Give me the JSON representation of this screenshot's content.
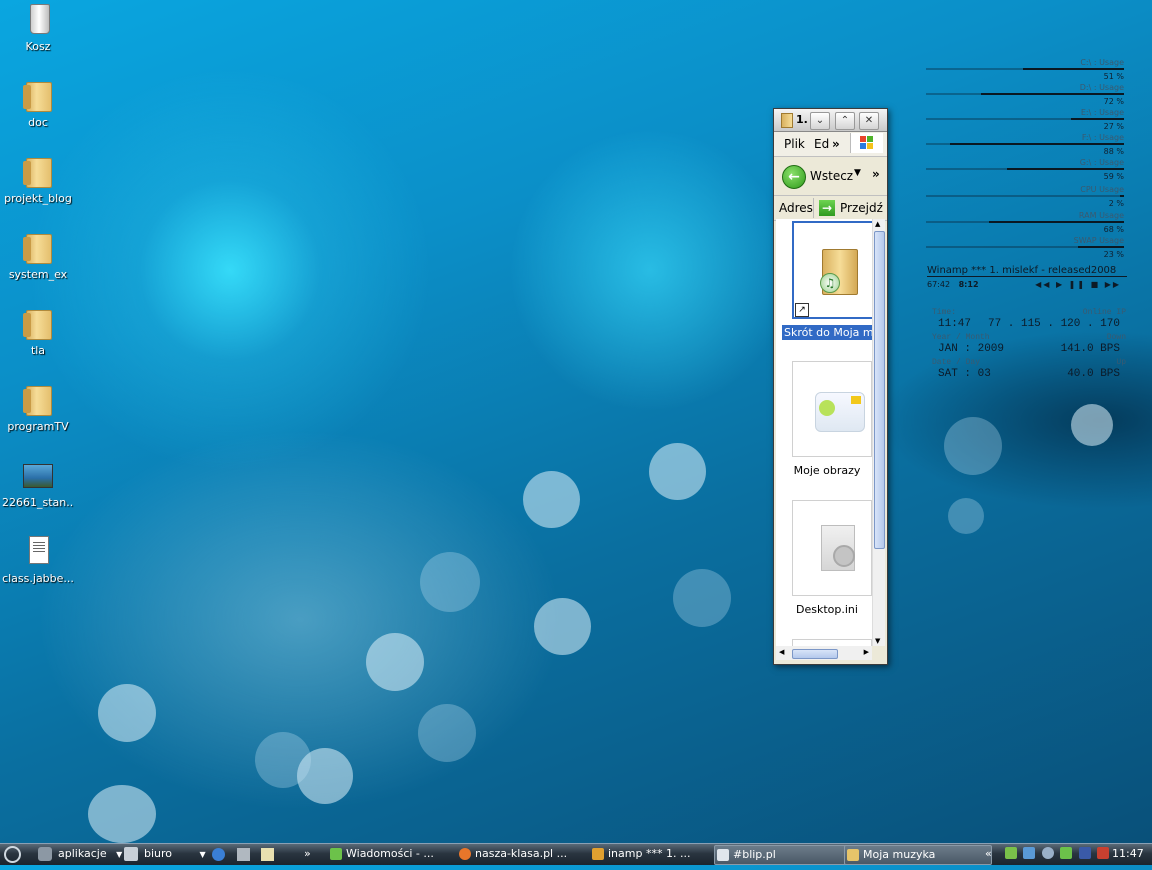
{
  "desktop_icons": [
    {
      "label": "Kosz",
      "icon": "trash-icon"
    },
    {
      "label": "doc",
      "icon": "folder-icon"
    },
    {
      "label": "projekt_blog",
      "icon": "folder-icon"
    },
    {
      "label": "system_ex",
      "icon": "folder-icon"
    },
    {
      "label": "tla",
      "icon": "folder-icon"
    },
    {
      "label": "programTV",
      "icon": "folder-icon"
    },
    {
      "label": "22661_stan...",
      "icon": "image-file-icon"
    },
    {
      "label": "class.jabbe...",
      "icon": "text-file-icon"
    }
  ],
  "explorer": {
    "title": "1.",
    "menu": {
      "file": "Plik",
      "edit": "Ed",
      "more": "»"
    },
    "toolbar": {
      "back": "Wstecz",
      "more": "»"
    },
    "address": {
      "label": "Adres",
      "go": "Przejdź"
    },
    "items": [
      {
        "caption": "Skrót do Moja mu",
        "selected": true
      },
      {
        "caption": "Moje obrazy",
        "selected": false
      },
      {
        "caption": "Desktop.ini",
        "selected": false
      }
    ]
  },
  "monitor": {
    "rows": [
      {
        "label": "C:\\ : Usage",
        "value": "51 %",
        "fraction": 0.51
      },
      {
        "label": "D:\\ : Usage",
        "value": "72 %",
        "fraction": 0.72
      },
      {
        "label": "E:\\ : Usage",
        "value": "27 %",
        "fraction": 0.27
      },
      {
        "label": "F:\\ : Usage",
        "value": "88 %",
        "fraction": 0.88
      },
      {
        "label": "G:\\ : Usage",
        "value": "59 %",
        "fraction": 0.59
      },
      {
        "label": "CPU Usage",
        "value": "2 %",
        "fraction": 0.02
      },
      {
        "label": "RAM Usage",
        "value": "68 %",
        "fraction": 0.68
      },
      {
        "label": "SWAP Usage",
        "value": "23 %",
        "fraction": 0.23
      }
    ],
    "winamp": {
      "title": "Winamp *** 1. mislekf - released2008",
      "elapsed": "67:42",
      "total": "8:12"
    },
    "info": {
      "time_label": "Time:",
      "time": "11:47",
      "ip_label": "Online IP",
      "ip": "77 . 115 . 120 . 170",
      "ym_label": "Year / Month",
      "ym": "JAN : 2009",
      "down_label": "Down",
      "down": "141.0 BPS",
      "dd_label": "Date / Day",
      "dd": "SAT : 03",
      "up_label": "Up",
      "up": "40.0 BPS"
    }
  },
  "taskbar": {
    "start_menu": "aplikacje",
    "quick_menu": "biuro",
    "chevron": "»",
    "tasks": [
      {
        "label": "Wiadomości - ...",
        "active": false
      },
      {
        "label": "nasza-klasa.pl ...",
        "active": false
      },
      {
        "label": "inamp *** 1. ...",
        "active": false
      },
      {
        "label": "#blip.pl",
        "active": true
      },
      {
        "label": "Moja muzyka",
        "active": true
      }
    ],
    "tray_chevron": "«",
    "clock": "11:47"
  }
}
